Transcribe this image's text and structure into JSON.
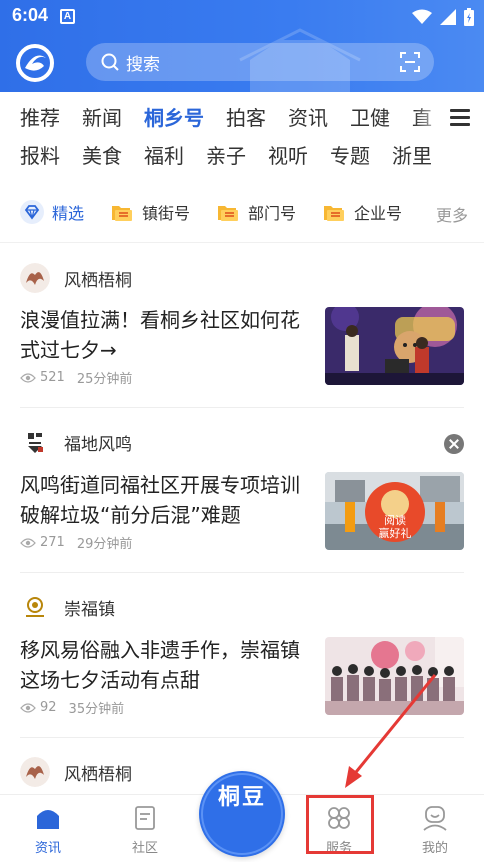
{
  "status_bar": {
    "time": "6:04",
    "badge": "A"
  },
  "search": {
    "placeholder": "搜索"
  },
  "tabs": {
    "row1": [
      "推荐",
      "新闻",
      "桐乡号",
      "拍客",
      "资讯",
      "卫健",
      "直"
    ],
    "row2": [
      "报料",
      "美食",
      "福利",
      "亲子",
      "视听",
      "专题",
      "浙里"
    ],
    "active": "桐乡号"
  },
  "subnav": {
    "items": [
      {
        "label": "精选",
        "icon": "diamond-icon"
      },
      {
        "label": "镇街号",
        "icon": "folder-icon"
      },
      {
        "label": "部门号",
        "icon": "folder-icon"
      },
      {
        "label": "企业号",
        "icon": "folder-icon"
      }
    ],
    "more": "更多"
  },
  "feed": [
    {
      "source": "风栖梧桐",
      "title": "浪漫值拉满！看桐乡社区如何花式过七夕→",
      "views": "521",
      "time": "25分钟前"
    },
    {
      "source": "福地风鸣",
      "title": "风鸣街道同福社区开展专项培训  破解垃圾“前分后混”难题",
      "views": "271",
      "time": "29分钟前"
    },
    {
      "source": "崇福镇",
      "title": "移风易俗融入非遗手作，崇福镇这场七夕活动有点甜",
      "views": "92",
      "time": "35分钟前"
    },
    {
      "source": "风栖梧桐"
    }
  ],
  "thumb_text": {
    "reading": "阅读",
    "gift": "赢好礼"
  },
  "bottom_nav": {
    "items": [
      {
        "label": "资讯",
        "icon": "home-icon",
        "active": true
      },
      {
        "label": "社区",
        "icon": "document-icon",
        "active": false
      },
      {
        "label": "服务",
        "icon": "grid-icon",
        "active": false
      },
      {
        "label": "我的",
        "icon": "profile-icon",
        "active": false
      }
    ],
    "center_label": "桐豆"
  },
  "colors": {
    "brand": "#2f6fe8",
    "active": "#2b66d9",
    "annotation": "#e53935"
  }
}
